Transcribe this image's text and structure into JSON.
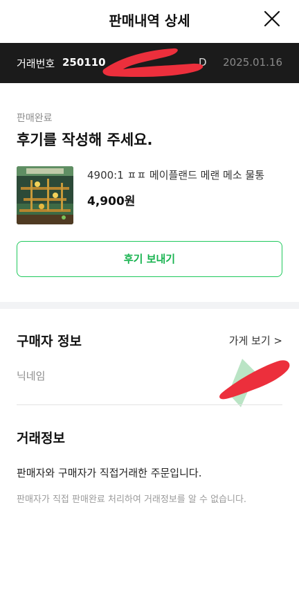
{
  "header": {
    "title": "판매내역 상세"
  },
  "order": {
    "label": "거래번호",
    "number_visible": "250110",
    "number_suffix": "D",
    "date": "2025.01.16"
  },
  "sale": {
    "status": "판매완료",
    "headline": "후기를 작성해 주세요."
  },
  "product": {
    "name": "4900:1 ㅍㅍ 메이플랜드 메랜 메소 물통",
    "price": "4,900원"
  },
  "review_button": {
    "label": "후기 보내기"
  },
  "buyer": {
    "title": "구매자 정보",
    "shop_link": "가게 보기 >",
    "nickname_label": "닉네임"
  },
  "trade": {
    "title": "거래정보",
    "description": "판매자와 구매자가 직접거래한 주문입니다.",
    "note": "판매자가 직접 판매완료 처리하여 거래정보를 알 수 없습니다."
  },
  "colors": {
    "accent_green": "#1ec85b",
    "order_bar_bg": "#1b1b1b",
    "redaction_red": "#ec2f3c"
  }
}
